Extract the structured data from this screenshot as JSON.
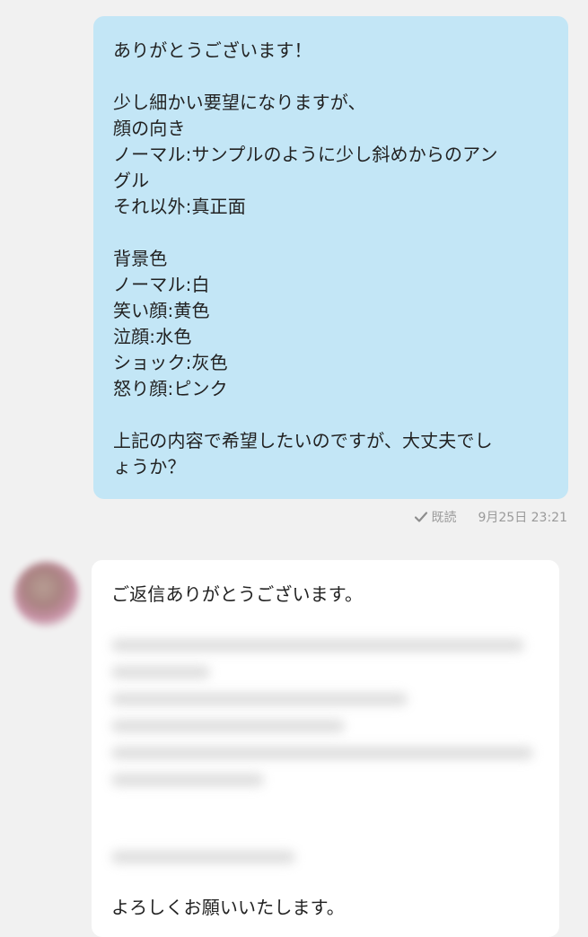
{
  "sent_message": {
    "lines": [
      "ありがとうございます！",
      "",
      "少し細かい要望になりますが、",
      "顔の向き",
      "ノーマル:サンプルのように少し斜めからのアン",
      "グル",
      "それ以外:真正面",
      "",
      "背景色",
      "ノーマル:白",
      "笑い顔:黄色",
      "泣顔:水色",
      "ショック:灰色",
      "怒り顔:ピンク",
      "",
      "上記の内容で希望したいのですが、大丈夫でし",
      "ょうか？"
    ],
    "read_status": "既読",
    "timestamp": "9月25日 23:21"
  },
  "received_message": {
    "top_line": "ご返信ありがとうございます。",
    "bottom_line": "よろしくお願いいたします。"
  },
  "colors": {
    "sent_bubble": "#c3e6f6",
    "received_bubble": "#ffffff",
    "background": "#f1f1f1",
    "meta_text": "#9a9a9a"
  },
  "icons": {
    "read": "check-icon",
    "avatar": "avatar"
  }
}
